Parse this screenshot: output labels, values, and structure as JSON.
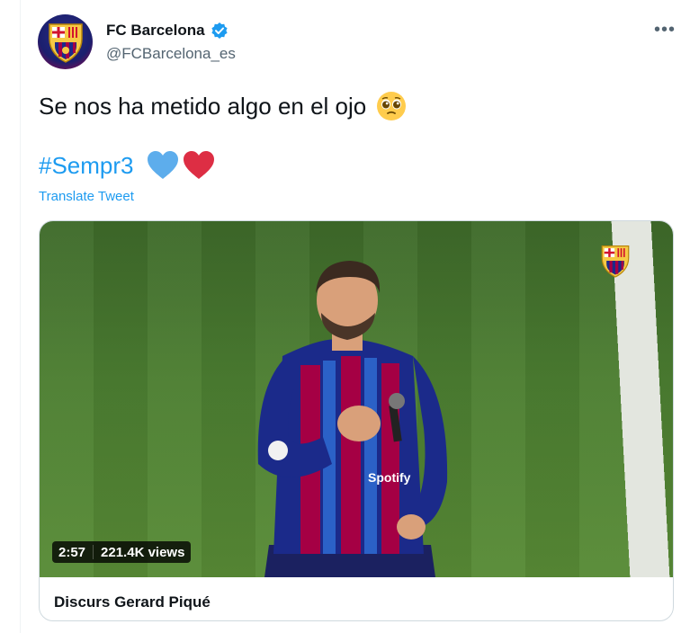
{
  "author": {
    "name": "FC Barcelona",
    "handle": "@FCBarcelona_es",
    "verified_icon": "verified-badge-icon"
  },
  "tweet": {
    "text": "Se nos ha metido algo en el ojo",
    "text_emoji": "pleading-face-emoji",
    "hashtag": "#Sempr3",
    "hashtag_emojis": [
      "blue-heart-emoji",
      "red-heart-emoji"
    ],
    "translate_label": "Translate Tweet"
  },
  "media": {
    "duration": "2:57",
    "views": "221.4K views",
    "caption": "Discurs Gerard Piqué"
  },
  "colors": {
    "link_blue": "#1d9bf0",
    "text": "#0f1419",
    "secondary": "#536471",
    "blaugrana_blue": "#1b2a8a",
    "blaugrana_red": "#a50044"
  }
}
